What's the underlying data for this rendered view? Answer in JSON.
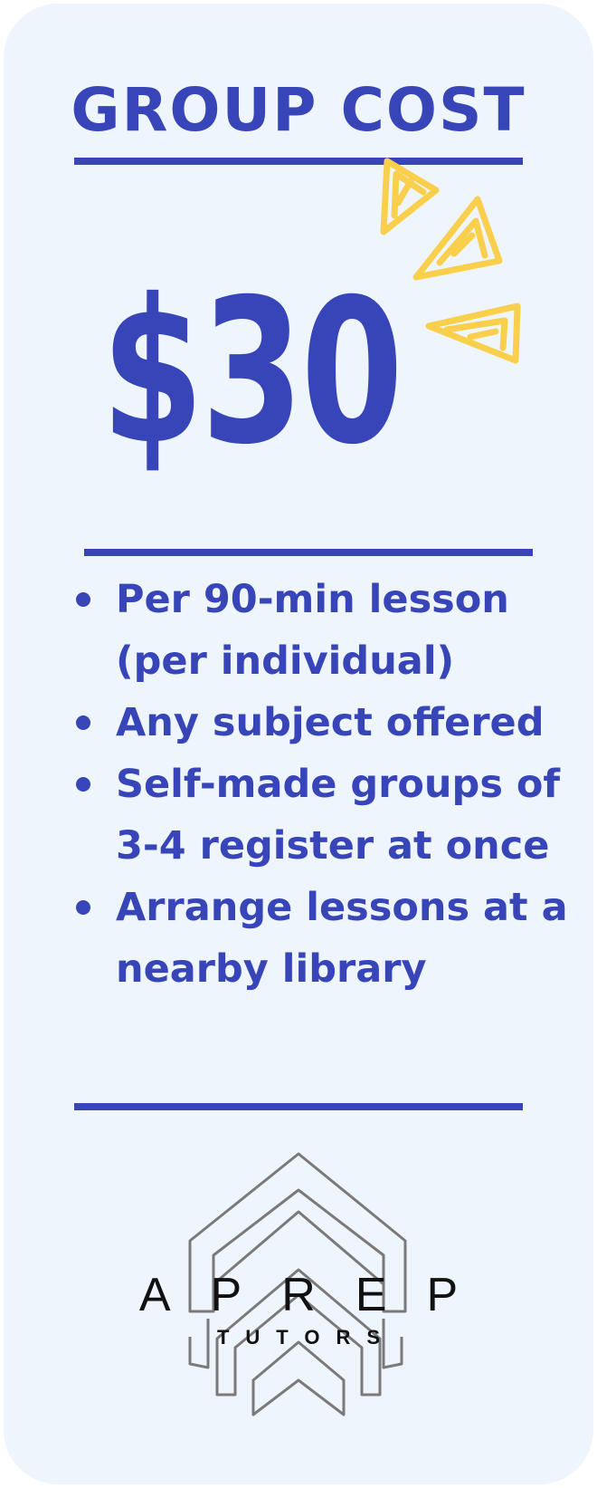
{
  "card": {
    "title": "GROUP COST",
    "price": "$30",
    "bullets": [
      "Per 90-min lesson (per individual)",
      "Any subject offered",
      "Self-made groups of 3-4 register at once",
      "Arrange lessons at a nearby library"
    ]
  },
  "logo": {
    "name": "APREP",
    "tagline": "TUTORS"
  },
  "colors": {
    "card_background": "#eef5fd",
    "accent_blue": "#3845b8",
    "sparkle_yellow": "#f9cf4c",
    "logo_gray": "#7a7a7a"
  },
  "icons": {
    "sparkles": "sparkle-triangles-icon",
    "logo_mark": "chevron-stack-logo-icon"
  }
}
